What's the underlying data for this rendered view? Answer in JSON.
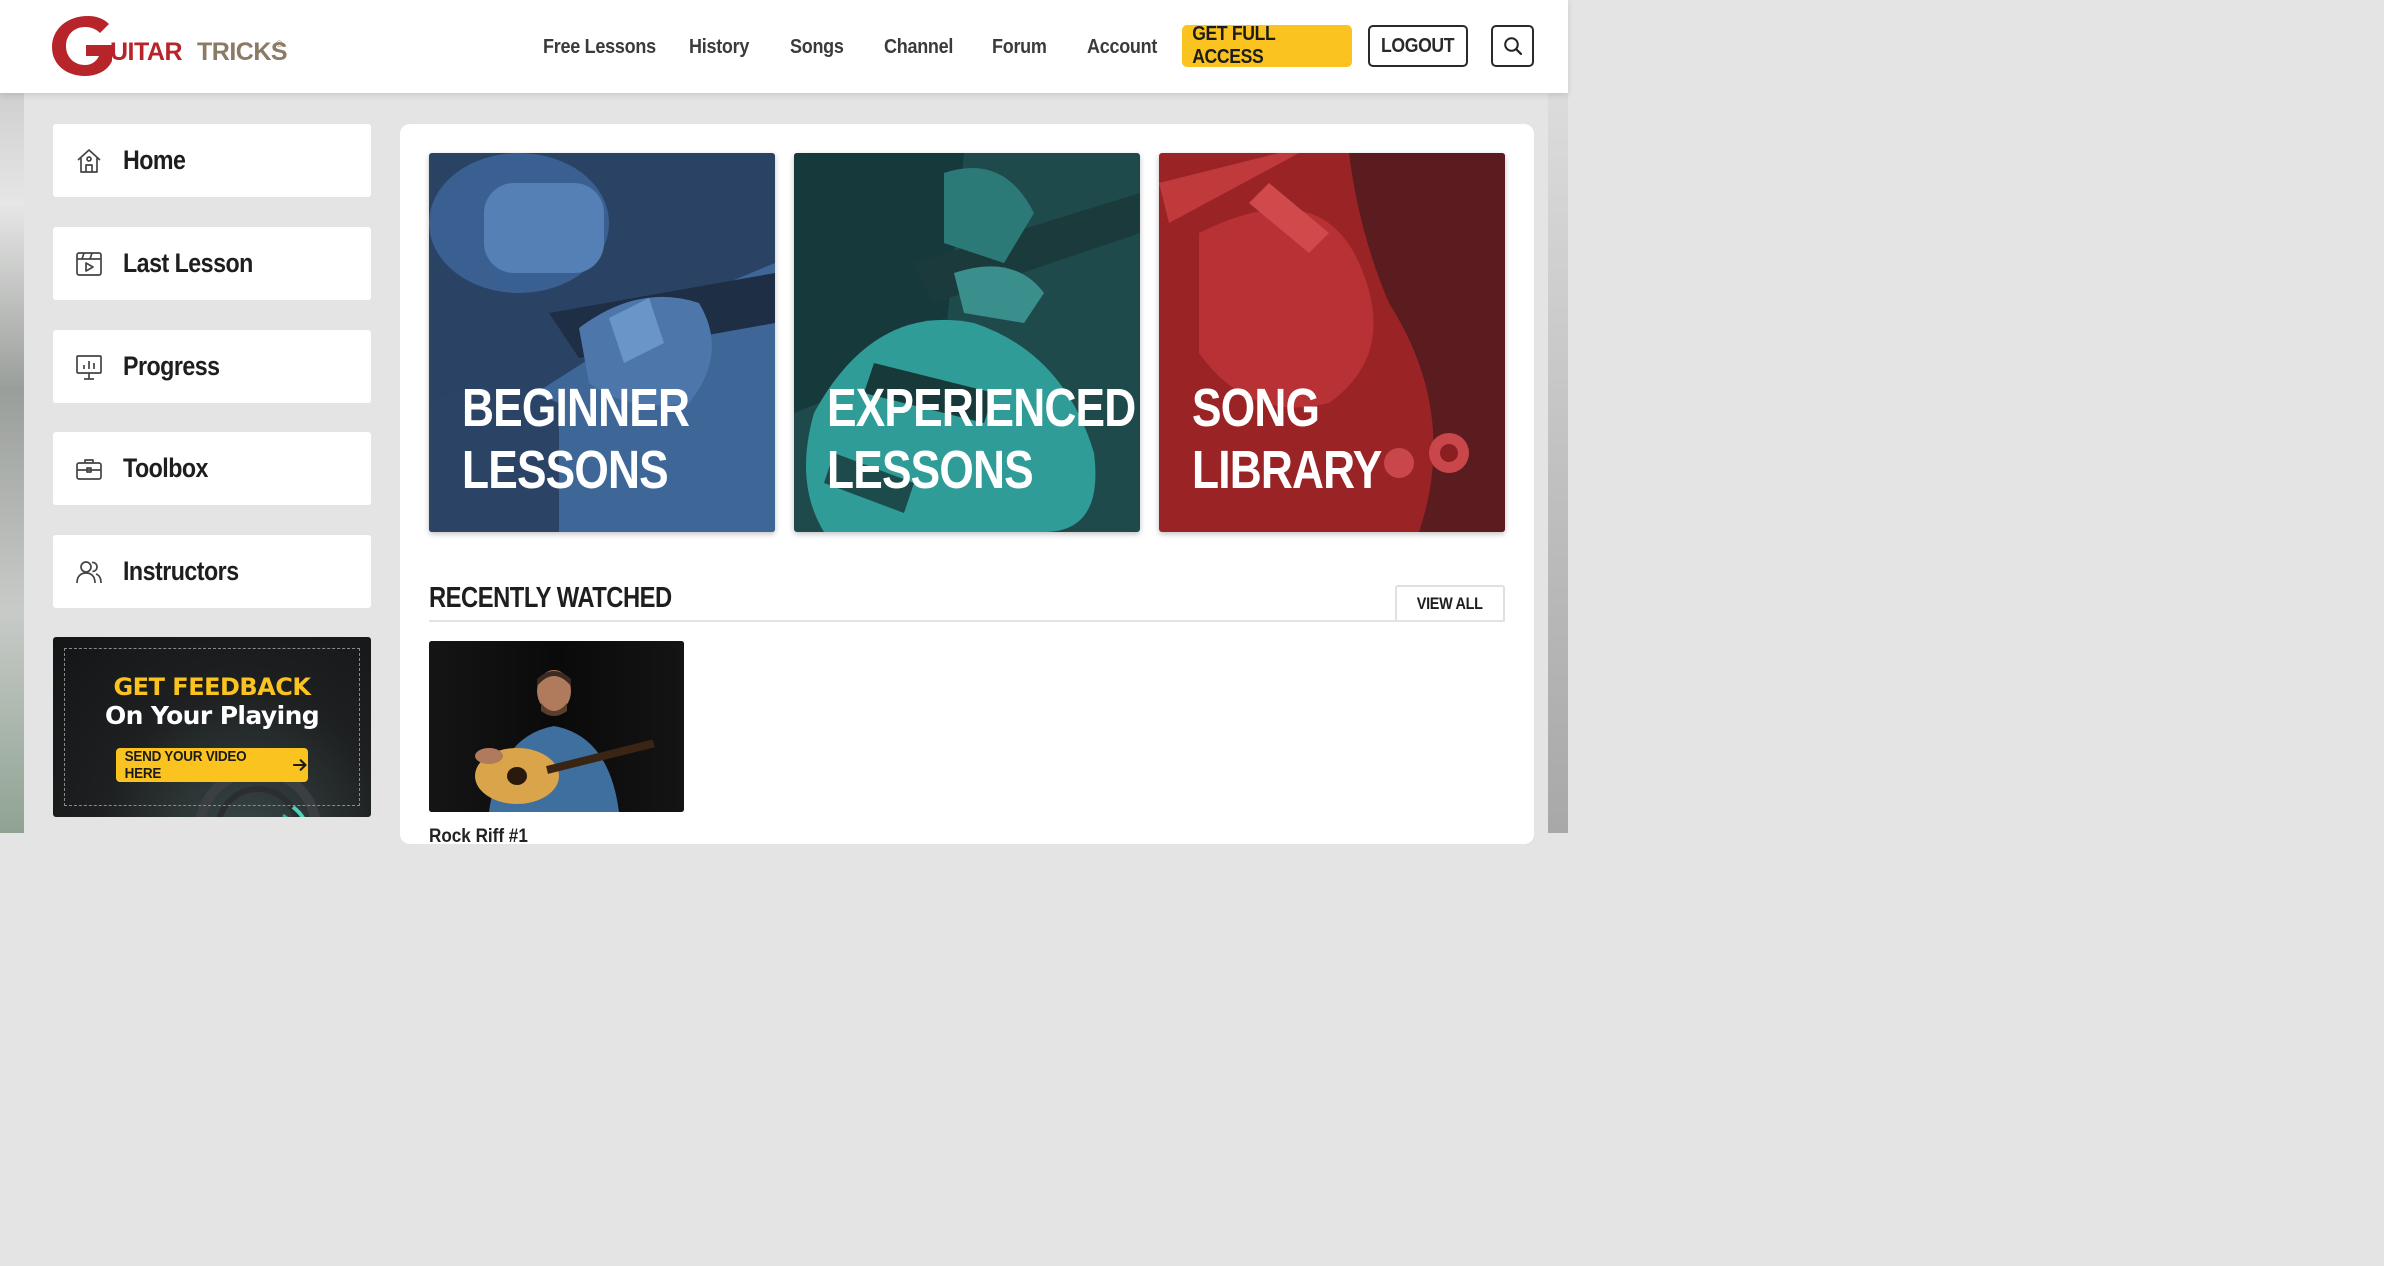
{
  "header": {
    "logo_text": "GUITARTRICKS",
    "nav": [
      "Free Lessons",
      "History",
      "Songs",
      "Channel",
      "Forum",
      "Account"
    ],
    "cta_label": "GET FULL ACCESS",
    "logout_label": "LOGOUT",
    "search_icon": "search-icon"
  },
  "sidebar": {
    "items": [
      {
        "label": "Home",
        "icon": "home-icon"
      },
      {
        "label": "Last Lesson",
        "icon": "video-play-icon"
      },
      {
        "label": "Progress",
        "icon": "progress-chart-icon"
      },
      {
        "label": "Toolbox",
        "icon": "toolbox-icon"
      },
      {
        "label": "Instructors",
        "icon": "instructors-icon"
      }
    ],
    "promo": {
      "title": "GET FEEDBACK",
      "subtitle": "On Your Playing",
      "button_label": "SEND YOUR VIDEO HERE"
    }
  },
  "main": {
    "cards": [
      {
        "line1": "BEGINNER",
        "line2": "LESSONS",
        "color": "#3a5f8f"
      },
      {
        "line1": "EXPERIENCED",
        "line2": "LESSONS",
        "color": "#1e6e6e"
      },
      {
        "line1": "SONG",
        "line2": "LIBRARY",
        "color": "#b0282b"
      }
    ],
    "recently_watched": {
      "title": "RECENTLY WATCHED",
      "view_all_label": "VIEW ALL",
      "items": [
        {
          "title": "Rock Riff #1"
        }
      ]
    }
  },
  "colors": {
    "accent": "#fbc31f",
    "brand_red": "#b7242a"
  }
}
